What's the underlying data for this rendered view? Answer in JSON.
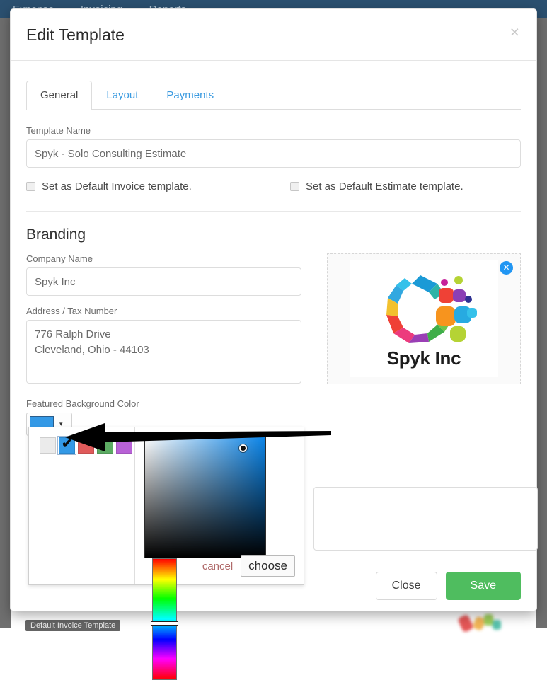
{
  "navbar": {
    "items": [
      {
        "label": "Expense",
        "caret": "▾"
      },
      {
        "label": "Invoicing",
        "caret": "▾"
      },
      {
        "label": "Reports",
        "caret": ""
      }
    ]
  },
  "background": {
    "badge_label": "Default Invoice Template"
  },
  "modal": {
    "title": "Edit Template",
    "close_icon": "×",
    "tabs": [
      {
        "label": "General",
        "active": true
      },
      {
        "label": "Layout",
        "active": false
      },
      {
        "label": "Payments",
        "active": false
      }
    ],
    "template_name": {
      "label": "Template Name",
      "value": "Spyk - Solo Consulting Estimate",
      "placeholder": "Template Name"
    },
    "checkboxes": [
      {
        "label": "Set as Default Invoice template.",
        "checked": false
      },
      {
        "label": "Set as Default Estimate template.",
        "checked": false
      }
    ],
    "branding": {
      "heading": "Branding",
      "company_name": {
        "label": "Company Name",
        "value": "Spyk Inc",
        "placeholder": "Company Name"
      },
      "address": {
        "label": "Address / Tax Number",
        "value": "776 Ralph Drive\nCleveland, Ohio - 44103",
        "placeholder": "Address / Tax Number"
      },
      "logo": {
        "company_label": "Spyk Inc",
        "remove_icon": "✕"
      },
      "notes": {
        "value": "",
        "placeholder": ""
      }
    },
    "color": {
      "label": "Featured Background Color",
      "selected_hex": "#3399e6",
      "caret_icon": "▾",
      "swatches": [
        {
          "hex": "#ebebeb",
          "selected": false
        },
        {
          "hex": "#3399e6",
          "selected": true
        },
        {
          "hex": "#e05a5a",
          "selected": false
        },
        {
          "hex": "#5cab63",
          "selected": false
        },
        {
          "hex": "#b861d6",
          "selected": false
        }
      ],
      "check_icon": "✔",
      "cancel_label": "cancel",
      "choose_label": "choose"
    },
    "footer": {
      "close_label": "Close",
      "save_label": "Save"
    }
  },
  "annotation": {
    "arrow_color": "#000000"
  }
}
